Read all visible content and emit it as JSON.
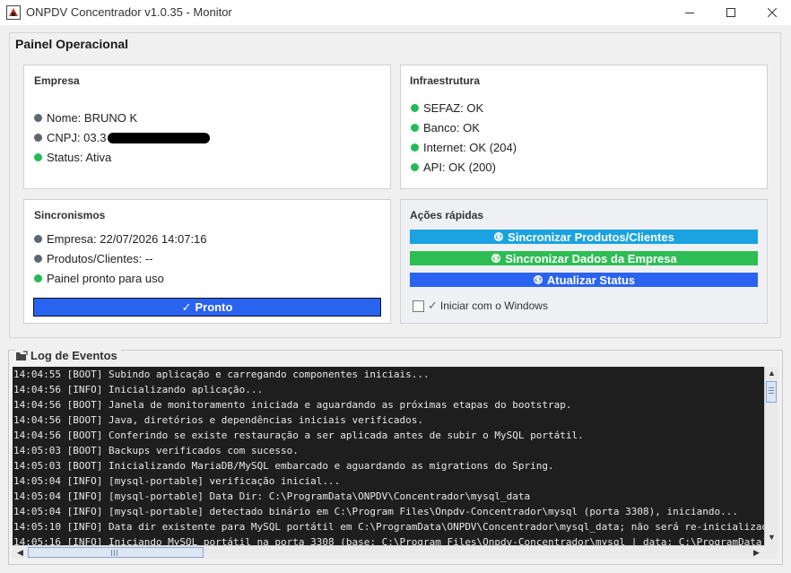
{
  "window": {
    "title": "ONPDV Concentrador v1.0.35 - Monitor",
    "minimize": "—",
    "maximize": "☐",
    "close": "✕"
  },
  "panel": {
    "title": "Painel Operacional"
  },
  "empresa": {
    "title": "Empresa",
    "nome": "Nome: BRUNO K",
    "cnpj": "CNPJ: 03.3",
    "status": "Status: Ativa"
  },
  "infra": {
    "title": "Infraestrutura",
    "sefaz": "SEFAZ: OK",
    "banco": "Banco: OK",
    "internet": "Internet: OK (204)",
    "api": "API: OK (200)"
  },
  "sync": {
    "title": "Sincronismos",
    "empresa": "Empresa: 22/07/2026 14:07:16",
    "produtos": "Produtos/Clientes: --",
    "painel": "Painel pronto para uso",
    "button": "Pronto",
    "button_icon": "✓"
  },
  "actions": {
    "title": "Ações rápidas",
    "sync_produtos": "Sincronizar Produtos/Clientes",
    "sync_empresa": "Sincronizar Dados da Empresa",
    "atualizar": "Atualizar Status",
    "checkbox_icon": "✓",
    "checkbox_label": "Iniciar com o Windows",
    "colors": {
      "cyan": "#1aa3e0",
      "green": "#2ebd55",
      "blue": "#2a63f0"
    }
  },
  "log": {
    "title": "Log de Eventos",
    "lines": [
      "14:04:55 [BOOT] Subindo aplicação e carregando componentes iniciais...",
      "14:04:56 [INFO] Inicializando aplicação...",
      "14:04:56 [BOOT] Janela de monitoramento iniciada e aguardando as próximas etapas do bootstrap.",
      "14:04:56 [BOOT] Java, diretórios e dependências iniciais verificados.",
      "14:04:56 [BOOT] Conferindo se existe restauração a ser aplicada antes de subir o MySQL portátil.",
      "14:05:03 [BOOT] Backups verificados com sucesso.",
      "14:05:03 [BOOT] Inicializando MariaDB/MySQL embarcado e aguardando as migrations do Spring.",
      "14:05:04 [INFO] [mysql-portable] verificação inicial...",
      "14:05:04 [INFO] [mysql-portable] Data Dir: C:\\ProgramData\\ONPDV\\Concentrador\\mysql_data",
      "14:05:04 [INFO] [mysql-portable] detectado binário em C:\\Program Files\\Onpdv-Concentrador\\mysql (porta 3308), iniciando...",
      "14:05:10 [INFO] Data dir existente para MySQL portátil em C:\\ProgramData\\ONPDV\\Concentrador\\mysql_data; não será re-inicializado.",
      "14:05:16 [INFO] Iniciando MySQL portátil na porta 3308 (base: C:\\Program Files\\Onpdv-Concentrador\\mysql | data: C:\\ProgramData)"
    ]
  }
}
